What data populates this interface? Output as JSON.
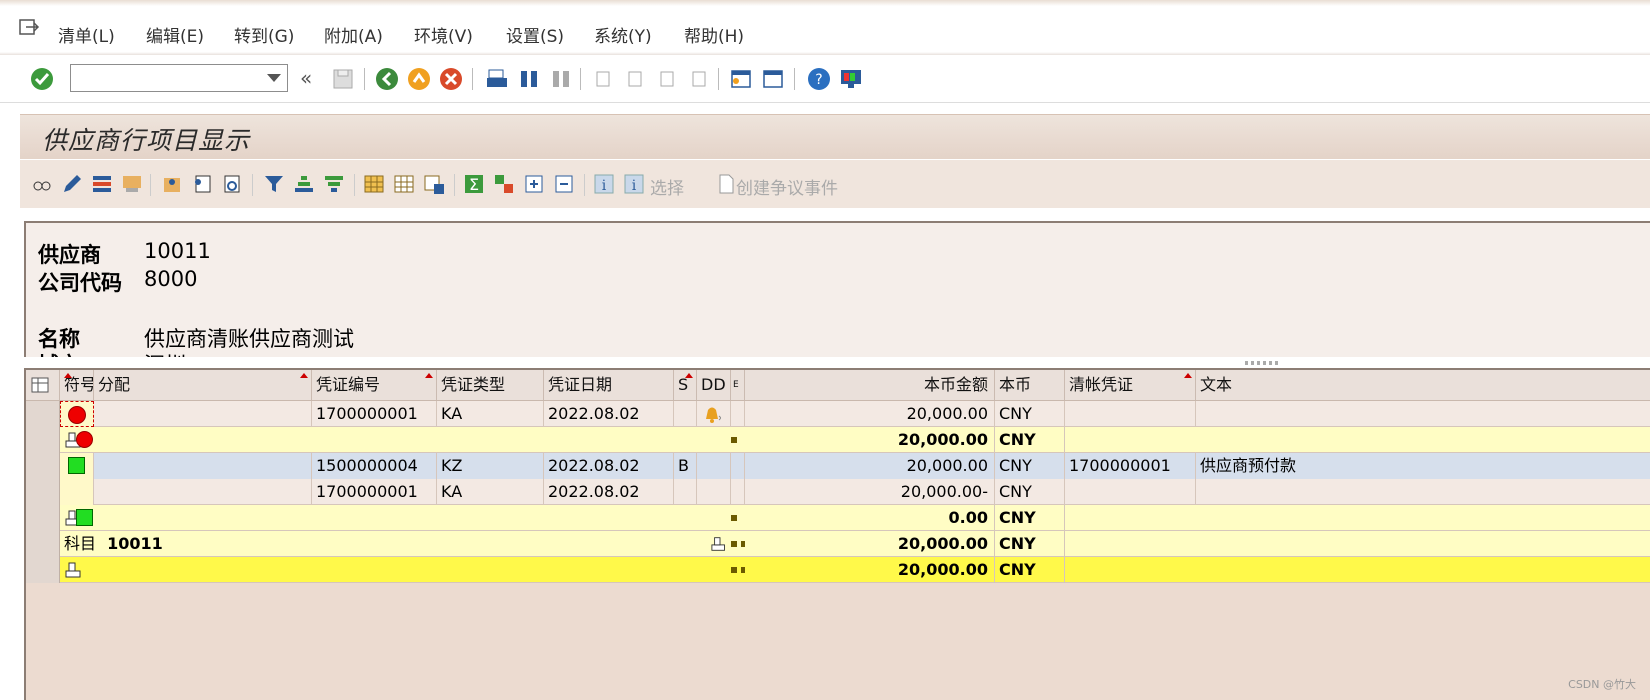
{
  "menu": {
    "items": [
      "清单(L)",
      "编辑(E)",
      "转到(G)",
      "附加(A)",
      "环境(V)",
      "设置(S)",
      "系统(Y)",
      "帮助(H)"
    ]
  },
  "toolbar": {
    "command_value": "",
    "icons": [
      "check-icon",
      "back-icon",
      "exit-icon",
      "cancel-icon",
      "print-icon",
      "find-icon",
      "find-next-icon",
      "first-page-icon",
      "prev-page-icon",
      "next-page-icon",
      "last-page-icon",
      "new-session-icon",
      "shortcut-icon",
      "help-icon",
      "layout-icon"
    ]
  },
  "title": "供应商行项目显示",
  "app_toolbar": {
    "select_label": "选择",
    "dispute_label": "创建争议事件"
  },
  "header": {
    "vendor_label": "供应商",
    "vendor_value": "10011",
    "company_label": "公司代码",
    "company_value": "8000",
    "name_label": "名称",
    "name_value": "供应商清账供应商测试",
    "city_label": "城市",
    "city_value": "深圳"
  },
  "grid": {
    "columns": [
      "符号",
      "分配",
      "凭证编号",
      "凭证类型",
      "凭证日期",
      "S",
      "DD",
      "E",
      "本币金额",
      "本币",
      "清帐凭证",
      "文本"
    ],
    "rows": [
      {
        "type": "item",
        "status": "red",
        "doc": "1700000001",
        "dtype": "KA",
        "date": "2022.08.02",
        "s": "",
        "amount": "20,000.00",
        "cur": "CNY",
        "clear": "",
        "text": ""
      },
      {
        "type": "subtotal",
        "status": "red",
        "amount": "20,000.00",
        "cur": "CNY"
      },
      {
        "type": "item",
        "status": "green",
        "doc": "1500000004",
        "dtype": "KZ",
        "date": "2022.08.02",
        "s": "B",
        "amount": "20,000.00",
        "cur": "CNY",
        "clear": "1700000001",
        "text": "供应商预付款"
      },
      {
        "type": "item",
        "status": "",
        "doc": "1700000001",
        "dtype": "KA",
        "date": "2022.08.02",
        "s": "",
        "amount": "20,000.00-",
        "cur": "CNY",
        "clear": "",
        "text": ""
      },
      {
        "type": "subtotal",
        "status": "green",
        "amount": "0.00",
        "cur": "CNY"
      },
      {
        "type": "account",
        "label": "科目",
        "account": "10011",
        "amount": "20,000.00",
        "cur": "CNY"
      },
      {
        "type": "total",
        "amount": "20,000.00",
        "cur": "CNY"
      }
    ]
  },
  "watermark": "CSDN @竹大",
  "colors": {
    "subtotal_bg": "#fffdc4",
    "total_bg": "#fff94a",
    "selected_bg": "#d6dfec",
    "item_bg": "#f3e9e3"
  }
}
